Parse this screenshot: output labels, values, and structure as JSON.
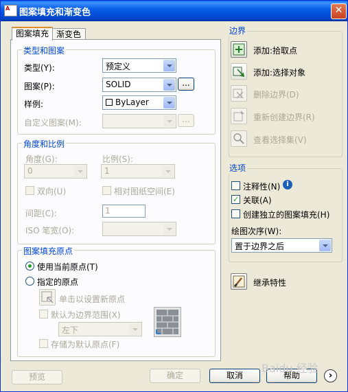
{
  "window": {
    "title": "图案填充和渐变色",
    "close_label": "✕",
    "app_icon_text": "A"
  },
  "tabs": [
    {
      "label": "图案填充"
    },
    {
      "label": "渐变色"
    }
  ],
  "type_pattern": {
    "title": "类型和图案",
    "type_label": "类型(Y):",
    "type_value": "预定义",
    "pattern_label": "图案(P):",
    "pattern_value": "SOLID",
    "pattern_browse": "...",
    "swatch_label": "样例:",
    "swatch_value": "ByLayer",
    "custom_label": "自定义图案(M):",
    "custom_value": "",
    "custom_browse": "..."
  },
  "angle_scale": {
    "title": "角度和比例",
    "angle_label": "角度(G):",
    "angle_value": "0",
    "scale_label": "比例(S):",
    "scale_value": "1",
    "double_label": "双向(U)",
    "relative_label": "相对图纸空间(E)",
    "spacing_label": "间距(C):",
    "spacing_value": "1",
    "iso_label": "ISO 笔宽(O):",
    "iso_value": ""
  },
  "origin": {
    "title": "图案填充原点",
    "current_label": "使用当前原点(T)",
    "specified_label": "指定的原点",
    "click_label": "单击以设置新原点",
    "default_extent_label": "默认为边界范围(X)",
    "position_value": "左下",
    "store_label": "存储为默认原点(F)"
  },
  "boundary": {
    "title": "边界",
    "add_pick": "添加:拾取点",
    "add_select": "添加:选择对象",
    "remove": "删除边界(D)",
    "recreate": "重新创建边界(R)",
    "view": "查看选择集(V)"
  },
  "options": {
    "title": "选项",
    "annotative_label": "注释性(N)",
    "associative_label": "关联(A)",
    "separate_label": "创建独立的图案填充(H)",
    "draw_order_label": "绘图次序(W):",
    "draw_order_value": "置于边界之后",
    "annotative_checked": false,
    "associative_checked": true,
    "separate_checked": false
  },
  "inherit": {
    "label": "继承特性"
  },
  "footer": {
    "preview": "预览",
    "ok": "确定",
    "cancel": "取消",
    "help": "帮助",
    "more": "›"
  },
  "watermark": "Baidu 经验"
}
